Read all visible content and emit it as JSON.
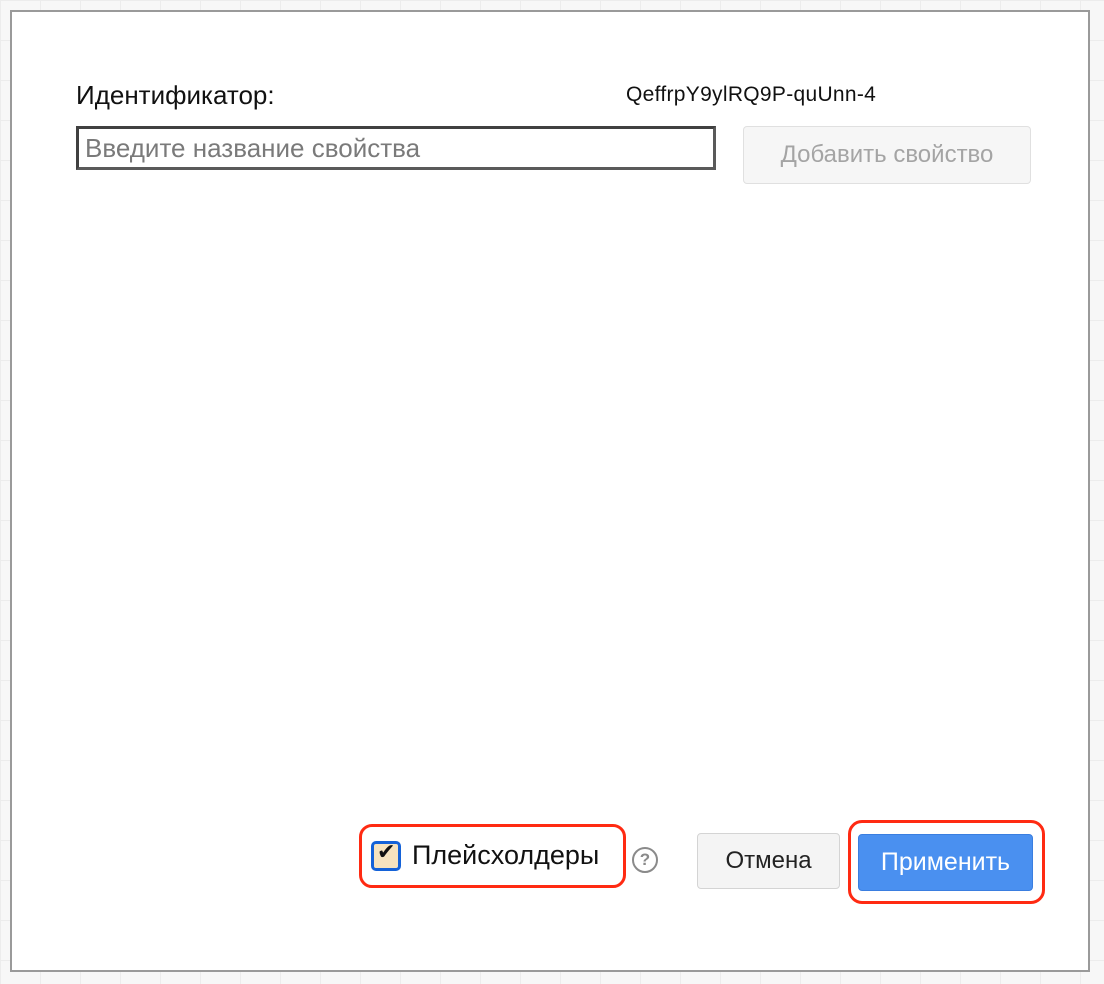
{
  "dialog": {
    "id_label": "Идентификатор:",
    "id_value": "QeffrpY9ylRQ9P-quUnn-4",
    "property_input": {
      "placeholder": "Введите название свойства",
      "value": ""
    },
    "add_property_label": "Добавить свойство",
    "placeholders": {
      "label": "Плейсхолдеры",
      "checked": true,
      "check_glyph": "✔"
    },
    "help_icon": "?",
    "cancel_label": "Отмена",
    "apply_label": "Применить"
  },
  "colors": {
    "accent": "#4a90f0",
    "highlight": "#ff2a12",
    "checkbox_border": "#1462d8"
  }
}
